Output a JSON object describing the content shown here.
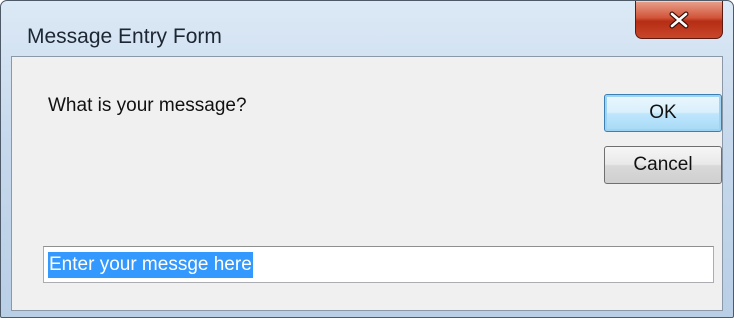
{
  "window": {
    "title": "Message Entry Form"
  },
  "dialog": {
    "prompt": "What is your message?",
    "ok_label": "OK",
    "cancel_label": "Cancel",
    "message_value": "Enter your messge here",
    "message_selected": true
  },
  "icons": {
    "close": "close-icon"
  },
  "colors": {
    "selection": "#3399ff",
    "close_button": "#c9462b",
    "default_button_border": "#3c7fb1"
  }
}
